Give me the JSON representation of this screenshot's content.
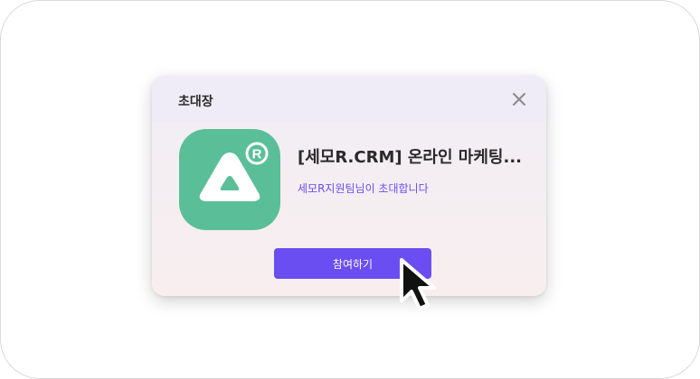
{
  "dialog": {
    "title": "초대장",
    "close_icon": "close-icon",
    "app_logo_icon": "semor-triangle-registered-logo",
    "event_title": "[세모R.CRM] 온라인 마케팅...",
    "invite_text": "세모R지원팀님이 초대합니다",
    "join_label": "참여하기"
  },
  "pointer": {
    "icon": "mouse-pointer-icon"
  },
  "colors": {
    "accent": "#6a4ef2",
    "logo_green": "#5abf99",
    "header_bg": "#efecf8",
    "body_bg": "#f5eef1"
  }
}
